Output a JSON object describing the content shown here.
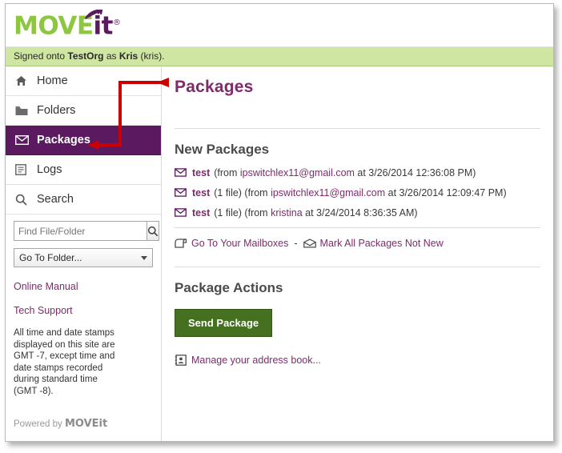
{
  "brand": {
    "logo_move": "MOVE",
    "logo_it": "it",
    "logo_reg": "®",
    "powered_by_prefix": "Powered by ",
    "powered_move": "MOVE",
    "powered_it": "it",
    "accent_purple": "#5b1a5f",
    "accent_link": "#7d2b6b",
    "accent_green": "#8dc63f",
    "strip_green": "#cfe5a2",
    "button_green": "#44701f",
    "annotation_red": "#cc0000"
  },
  "signed_on": {
    "prefix": "Signed onto ",
    "org": "TestOrg",
    "middle": " as ",
    "user": "Kris",
    "suffix": " (kris)."
  },
  "sidebar": {
    "items": [
      {
        "label": "Home",
        "icon": "home-icon",
        "active": false
      },
      {
        "label": "Folders",
        "icon": "folder-icon",
        "active": false
      },
      {
        "label": "Packages",
        "icon": "envelope-icon",
        "active": true
      },
      {
        "label": "Logs",
        "icon": "log-icon",
        "active": false
      },
      {
        "label": "Search",
        "icon": "search-icon",
        "active": false
      }
    ],
    "search": {
      "value": "",
      "placeholder": "Find File/Folder",
      "button_icon": "search-icon"
    },
    "folder_select": {
      "selected": "Go To Folder...",
      "options": [
        "Go To Folder..."
      ]
    },
    "links": [
      {
        "label": "Online Manual"
      },
      {
        "label": "Tech Support"
      }
    ],
    "time_note": "All time and date stamps displayed on this site are GMT -7, except time and date stamps recorded during standard time (GMT -8)."
  },
  "main": {
    "page_title": "Packages",
    "new_packages": {
      "heading": "New Packages",
      "rows": [
        {
          "icon": "envelope-icon",
          "subject": "test",
          "meta_pre": "(from ",
          "sender": "ipswitchlex11@gmail.com",
          "meta_post": " at 3/26/2014 12:36:08 PM)"
        },
        {
          "icon": "envelope-icon",
          "subject": "test",
          "meta_pre": "(1 file) (from ",
          "sender": "ipswitchlex11@gmail.com",
          "meta_post": " at 3/26/2014 12:09:47 PM)"
        },
        {
          "icon": "envelope-icon",
          "subject": "test",
          "meta_pre": "(1 file) (from ",
          "sender": "kristina",
          "meta_post": " at 3/24/2014 8:36:35 AM)"
        }
      ],
      "links": {
        "mailboxes_icon": "mailbox-icon",
        "mailboxes_label": "Go To Your Mailboxes",
        "separator": "-",
        "mark_icon": "open-envelope-icon",
        "mark_label": "Mark All Packages Not New"
      }
    },
    "package_actions": {
      "heading": "Package Actions",
      "send_button": "Send Package",
      "address_book_icon": "address-book-icon",
      "address_book_label": "Manage your address book..."
    }
  }
}
